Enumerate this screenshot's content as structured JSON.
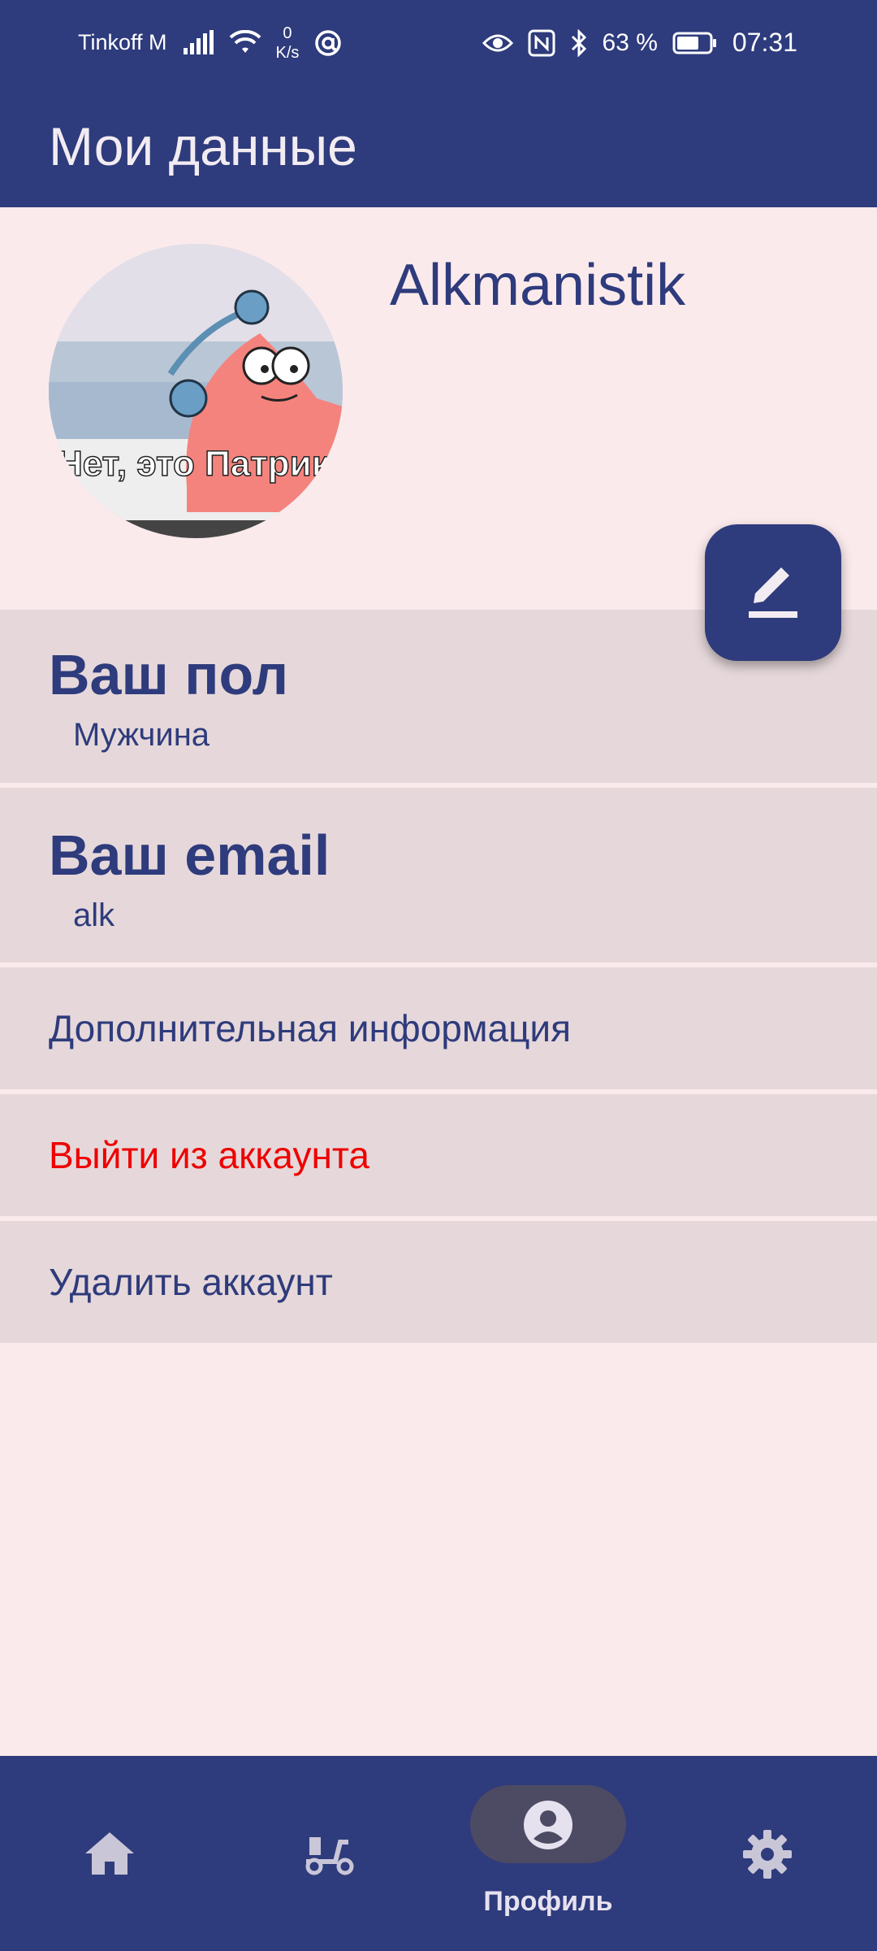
{
  "status_bar": {
    "carrier": "Tinkoff M",
    "speed_value": "0",
    "speed_unit": "K/s",
    "battery_percent": "63 %",
    "time": "07:31"
  },
  "app_bar": {
    "title": "Мои данные"
  },
  "profile": {
    "username": "Alkmanistik",
    "avatar_caption": "Нет, это Патрик"
  },
  "fields": [
    {
      "title": "Ваш пол",
      "value": "Мужчина"
    },
    {
      "title": "Ваш email",
      "value": "alk"
    }
  ],
  "actions": {
    "more_info": "Дополнительная информация",
    "logout": "Выйти из аккаунта",
    "delete": "Удалить аккаунт"
  },
  "bottom_nav": {
    "items": [
      {
        "icon": "home-icon"
      },
      {
        "icon": "scooter-icon"
      },
      {
        "icon": "profile-icon",
        "label": "Профиль",
        "selected": true
      },
      {
        "icon": "settings-icon"
      }
    ]
  },
  "colors": {
    "primary": "#2e3b7c",
    "background": "#fbeaec",
    "list_item": "#e6d8da",
    "danger": "#ee0000"
  }
}
